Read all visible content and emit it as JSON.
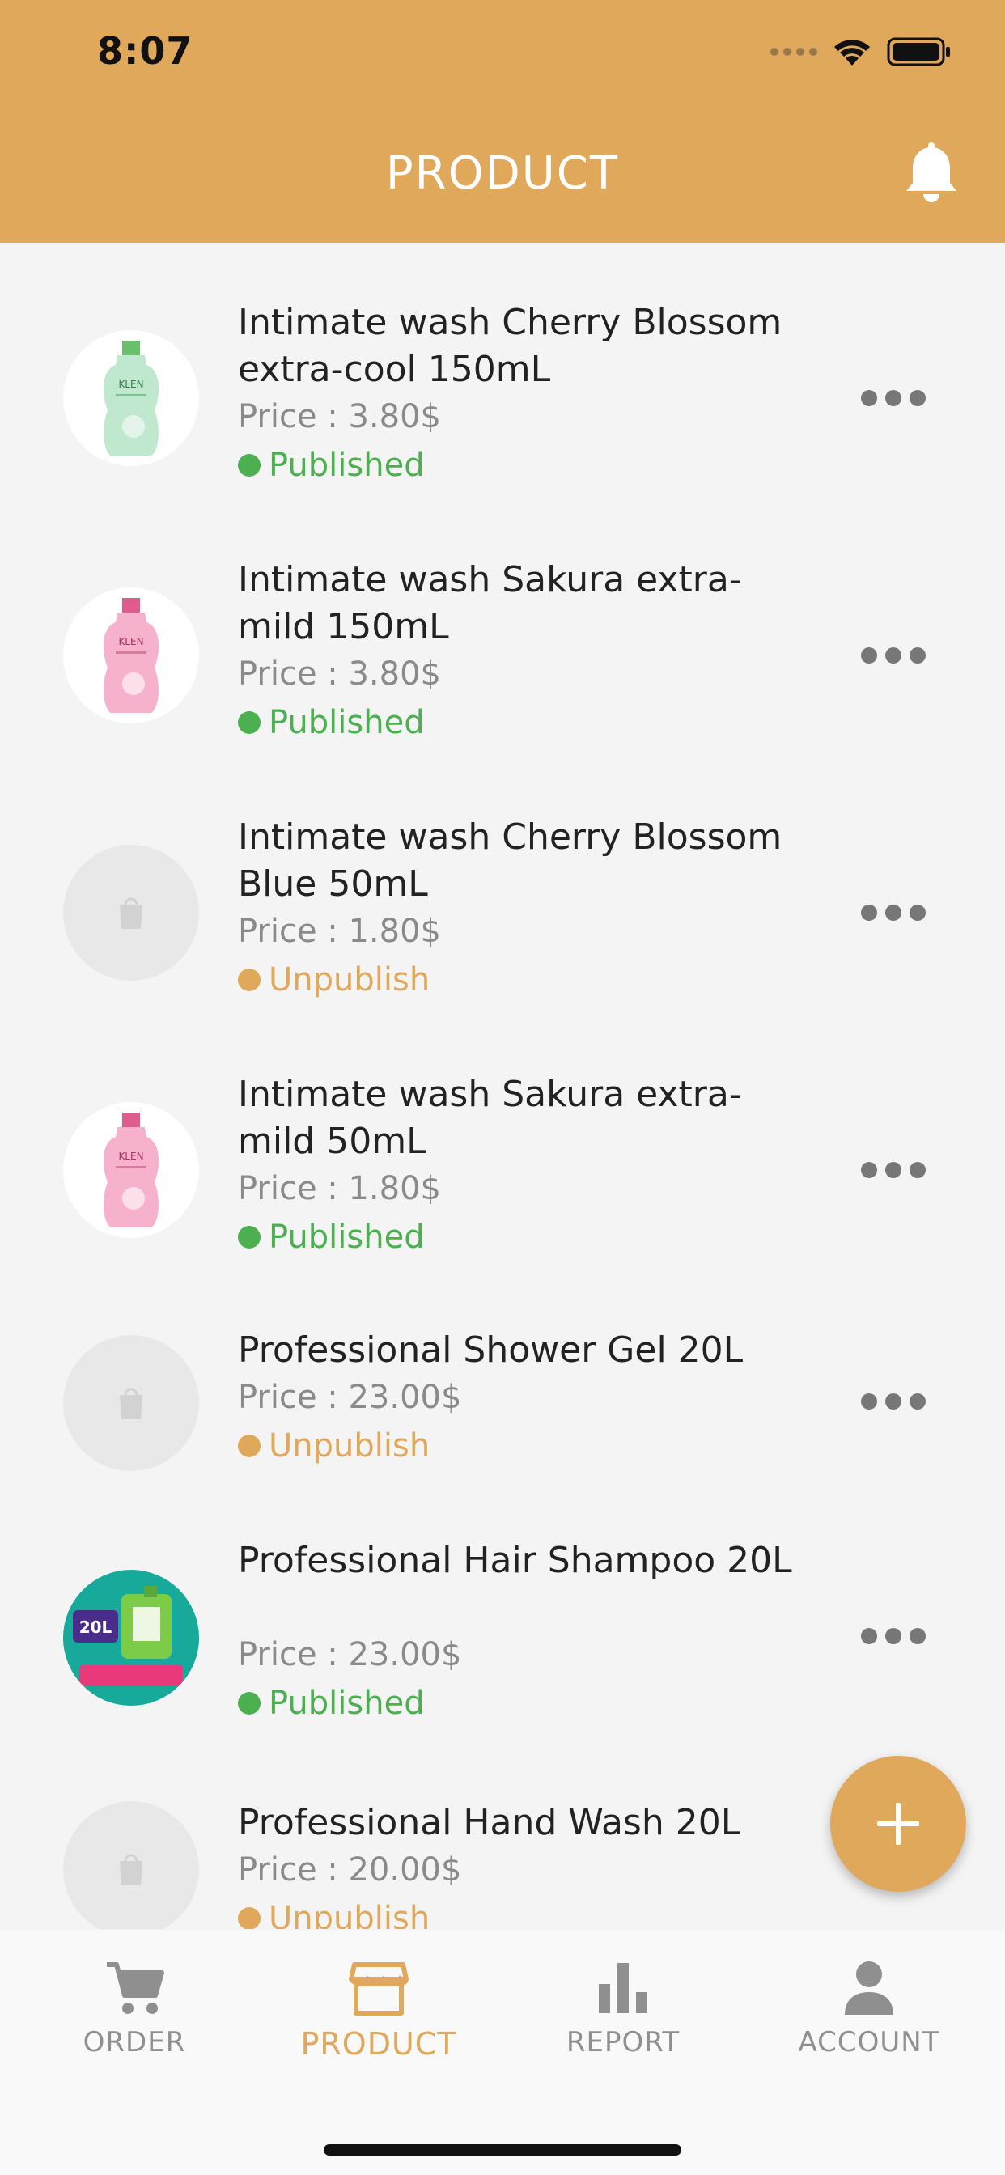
{
  "status_bar": {
    "time": "8:07"
  },
  "header": {
    "title": "PRODUCT",
    "bell_icon": "bell-icon"
  },
  "products": [
    {
      "name": "Intimate wash Cherry Blossom extra-cool 150mL",
      "price": "Price : 3.80$",
      "status": "Published",
      "image": "green-bottle"
    },
    {
      "name": "Intimate wash Sakura extra-mild 150mL",
      "price": "Price : 3.80$",
      "status": "Published",
      "image": "pink-bottle"
    },
    {
      "name": "Intimate wash Cherry Blossom Blue 50mL",
      "price": "Price : 1.80$",
      "status": "Unpublish",
      "image": "placeholder-bag"
    },
    {
      "name": "Intimate wash Sakura extra-mild 50mL",
      "price": "Price : 1.80$",
      "status": "Published",
      "image": "pink-bottle"
    },
    {
      "name": "Professional Shower Gel 20L",
      "price": "Price : 23.00$",
      "status": "Unpublish",
      "image": "placeholder-bag"
    },
    {
      "name": "Professional Hair Shampoo 20L",
      "price": "Price : 23.00$",
      "status": "Published",
      "image": "shampoo-jug"
    },
    {
      "name": "Professional Hand Wash 20L",
      "price": "Price : 20.00$",
      "status": "Unpublish",
      "image": "placeholder-bag"
    }
  ],
  "thumb_text": {
    "klen": "KLEN",
    "badge_20l": "20L"
  },
  "fab": {
    "icon": "plus-icon"
  },
  "tabs": [
    {
      "label": "ORDER",
      "icon": "cart-icon"
    },
    {
      "label": "PRODUCT",
      "icon": "store-icon"
    },
    {
      "label": "REPORT",
      "icon": "bar-chart-icon"
    },
    {
      "label": "ACCOUNT",
      "icon": "person-icon"
    }
  ],
  "colors": {
    "accent": "#dfa85a",
    "published": "#4caf50",
    "unpublish": "#dfa85a",
    "inactive_tab": "#8f8f8f"
  }
}
